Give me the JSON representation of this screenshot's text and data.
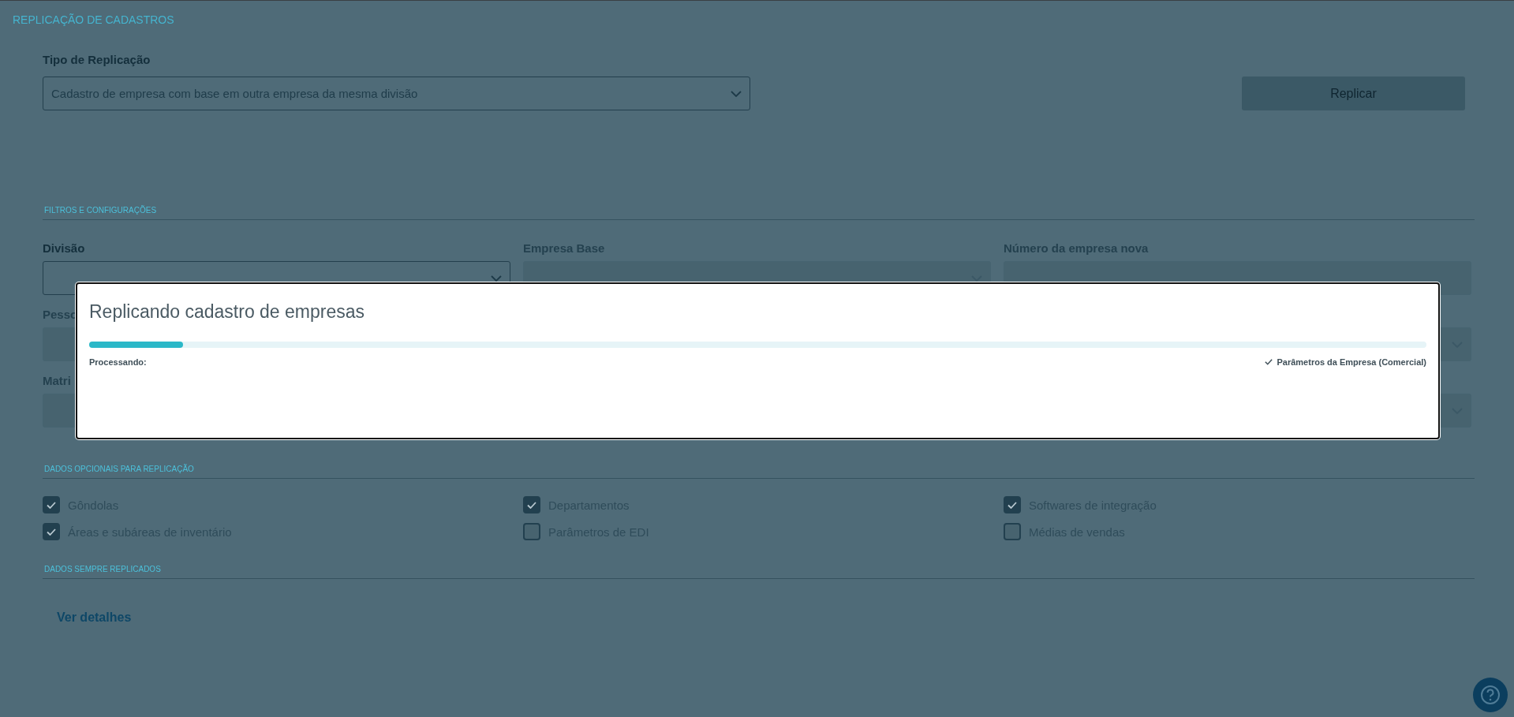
{
  "page_title": "REPLICAÇÃO DE CADASTROS",
  "replication_type": {
    "label": "Tipo de Replicação",
    "value": "Cadastro de empresa com base em outra empresa da mesma divisão"
  },
  "replicate_button": {
    "label": "Replicar",
    "disabled": true
  },
  "filters": {
    "title": "FILTROS E CONFIGURAÇÕES",
    "rows": [
      {
        "fields": [
          {
            "kind": "select",
            "label": "Divisão",
            "disabled": false
          },
          {
            "kind": "select",
            "label": "Empresa Base",
            "disabled": true
          },
          {
            "kind": "input",
            "label": "Número da empresa nova",
            "disabled": true
          }
        ]
      },
      {
        "fields": [
          {
            "kind": "input",
            "label": "Pesso",
            "disabled": true
          },
          {
            "kind": "covered"
          },
          {
            "kind": "select",
            "disabled": true
          }
        ]
      },
      {
        "fields": [
          {
            "kind": "input",
            "label": "Matri",
            "disabled": true
          },
          {
            "kind": "covered"
          },
          {
            "kind": "select",
            "disabled": true
          }
        ]
      }
    ]
  },
  "optional": {
    "title": "DADOS OPCIONAIS PARA REPLICAÇÃO",
    "options": [
      {
        "label": "Gôndolas",
        "checked": true
      },
      {
        "label": "Departamentos",
        "checked": true
      },
      {
        "label": "Softwares de integração",
        "checked": true
      },
      {
        "label": "Áreas e subáreas de inventário",
        "checked": true
      },
      {
        "label": "Parâmetros de EDI",
        "checked": false
      },
      {
        "label": "Médias de vendas",
        "checked": false
      }
    ]
  },
  "always": {
    "title": "DADOS SEMPRE REPLICADOS",
    "link": "Ver detalhes"
  },
  "modal": {
    "title": "Replicando cadastro de empresas",
    "level": 0.07,
    "status_label": "Processando:",
    "step": {
      "label": "Parâmetros da Empresa (Comercial)",
      "done": true
    }
  }
}
